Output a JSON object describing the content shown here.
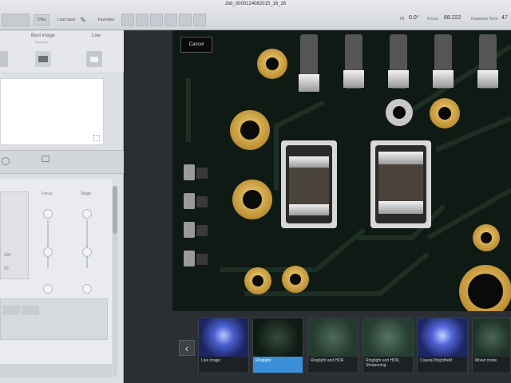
{
  "titlebar": {
    "title": "Job_0000124082015_16_26",
    "btn_dna": "DNa",
    "last_used": "Last used",
    "favorites": "Favorites",
    "tilt_label": "Tilt",
    "tilt_value": "0.0°",
    "focus_label": "Focus",
    "focus_value": "88.222",
    "exposure_label": "Exposure Time",
    "exposure_value": "47"
  },
  "left_panel": {
    "best_image_label": "Best image",
    "best_image_sub": "Exposure",
    "live_label": "Live",
    "focus_slider_label": "Focus",
    "stage_slider_label": "Stage",
    "value_a": "100",
    "value_b": "50",
    "value_c": "100"
  },
  "viewer": {
    "cancel_label": "Cancel"
  },
  "strip": {
    "thumbs": [
      {
        "caption": "Live image"
      },
      {
        "caption": "Ringlight"
      },
      {
        "caption": "Ringlight and HDR"
      },
      {
        "caption": "Ringlight and HDR, Sharpening"
      },
      {
        "caption": "Coaxial Brightfield"
      },
      {
        "caption": "Mixed mode"
      }
    ],
    "selected_index": 1
  },
  "colors": {
    "accent": "#3b8ed8",
    "pcb": "#0f1a15",
    "gold": "#d7a84a"
  }
}
